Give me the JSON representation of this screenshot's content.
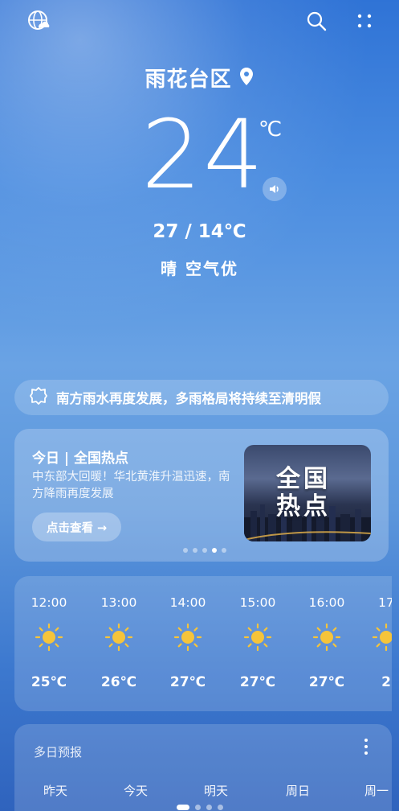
{
  "location": {
    "city": "雨花台区"
  },
  "current": {
    "temp": "24",
    "unit": "℃",
    "range": "27 / 14℃",
    "condition": "晴 空气优"
  },
  "alert": {
    "text": "南方雨水再度发展，多雨格局将持续至清明假"
  },
  "news": {
    "title": "今日 | 全国热点",
    "description": "中东部大回暖！华北黄淮升温迅速，南方降雨再度发展",
    "button": "点击查看 →",
    "image_text_line1": "全国",
    "image_text_line2": "热点",
    "page_count": 5,
    "active_page": 4
  },
  "hourly": [
    {
      "time": "12:00",
      "icon": "sun-icon",
      "temp": "25℃"
    },
    {
      "time": "13:00",
      "icon": "sun-icon",
      "temp": "26℃"
    },
    {
      "time": "14:00",
      "icon": "sun-icon",
      "temp": "27℃"
    },
    {
      "time": "15:00",
      "icon": "sun-icon",
      "temp": "27℃"
    },
    {
      "time": "16:00",
      "icon": "sun-icon",
      "temp": "27℃"
    },
    {
      "time": "17",
      "icon": "sun-icon",
      "temp": "2"
    }
  ],
  "multi_day": {
    "title": "多日预报",
    "days": [
      "昨天",
      "今天",
      "明天",
      "周日",
      "周一"
    ]
  },
  "colors": {
    "accent": "#ffffff",
    "sun": "#f6c43a",
    "background_top": "#2f73d6"
  }
}
